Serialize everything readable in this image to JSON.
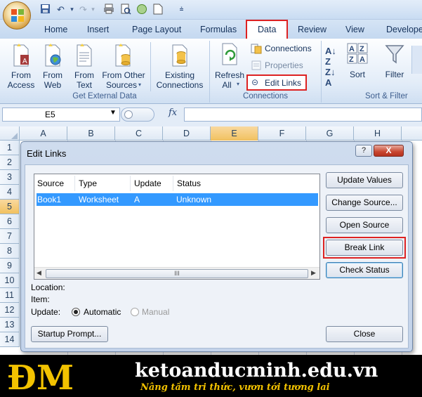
{
  "colors": {
    "accent_red": "#dd2222",
    "selection_blue": "#3399ff",
    "banner_gold": "#f2c200"
  },
  "tabs": [
    "Home",
    "Insert",
    "Page Layout",
    "Formulas",
    "Data",
    "Review",
    "View",
    "Develope"
  ],
  "ribbon": {
    "get_external_data": {
      "label": "Get External Data",
      "buttons": [
        {
          "line1": "From",
          "line2": "Access"
        },
        {
          "line1": "From",
          "line2": "Web"
        },
        {
          "line1": "From",
          "line2": "Text"
        },
        {
          "line1": "From Other",
          "line2": "Sources"
        },
        {
          "line1": "Existing",
          "line2": "Connections"
        }
      ]
    },
    "connections": {
      "label": "Connections",
      "refresh_line1": "Refresh",
      "refresh_line2": "All",
      "connections_label": "Connections",
      "properties_label": "Properties",
      "edit_links_label": "Edit Links"
    },
    "sort_filter": {
      "label": "Sort & Filter",
      "sort_label": "Sort",
      "filter_label": "Filter"
    }
  },
  "formula_bar": {
    "cell_ref": "E5",
    "fx_label": "fx",
    "value": ""
  },
  "columns": [
    "A",
    "B",
    "C",
    "D",
    "E",
    "F",
    "G",
    "H"
  ],
  "rows": [
    "1",
    "2",
    "3",
    "4",
    "5",
    "6",
    "7",
    "8",
    "9",
    "10",
    "11",
    "12",
    "13",
    "14"
  ],
  "dialog": {
    "title": "Edit Links",
    "help_label": "?",
    "close_label": "X",
    "list_headers": [
      "Source",
      "Type",
      "Update",
      "Status"
    ],
    "links": [
      {
        "source": "Book1",
        "type": "Worksheet",
        "update": "A",
        "status": "Unknown"
      }
    ],
    "scroll_grip": "III",
    "buttons": {
      "update_values": "Update Values",
      "change_source": "Change Source...",
      "open_source": "Open Source",
      "break_link": "Break Link",
      "check_status": "Check Status",
      "startup_prompt": "Startup Prompt...",
      "close": "Close"
    },
    "location_label": "Location:",
    "item_label": "Item:",
    "update_label": "Update:",
    "automatic_label": "Automatic",
    "manual_label": "Manual",
    "update_mode": "Automatic"
  },
  "banner": {
    "logo_text": "ĐM",
    "site": "ketoanducminh.edu.vn",
    "slogan": "Nâng tầm tri thức, vươn tới tương lai"
  }
}
